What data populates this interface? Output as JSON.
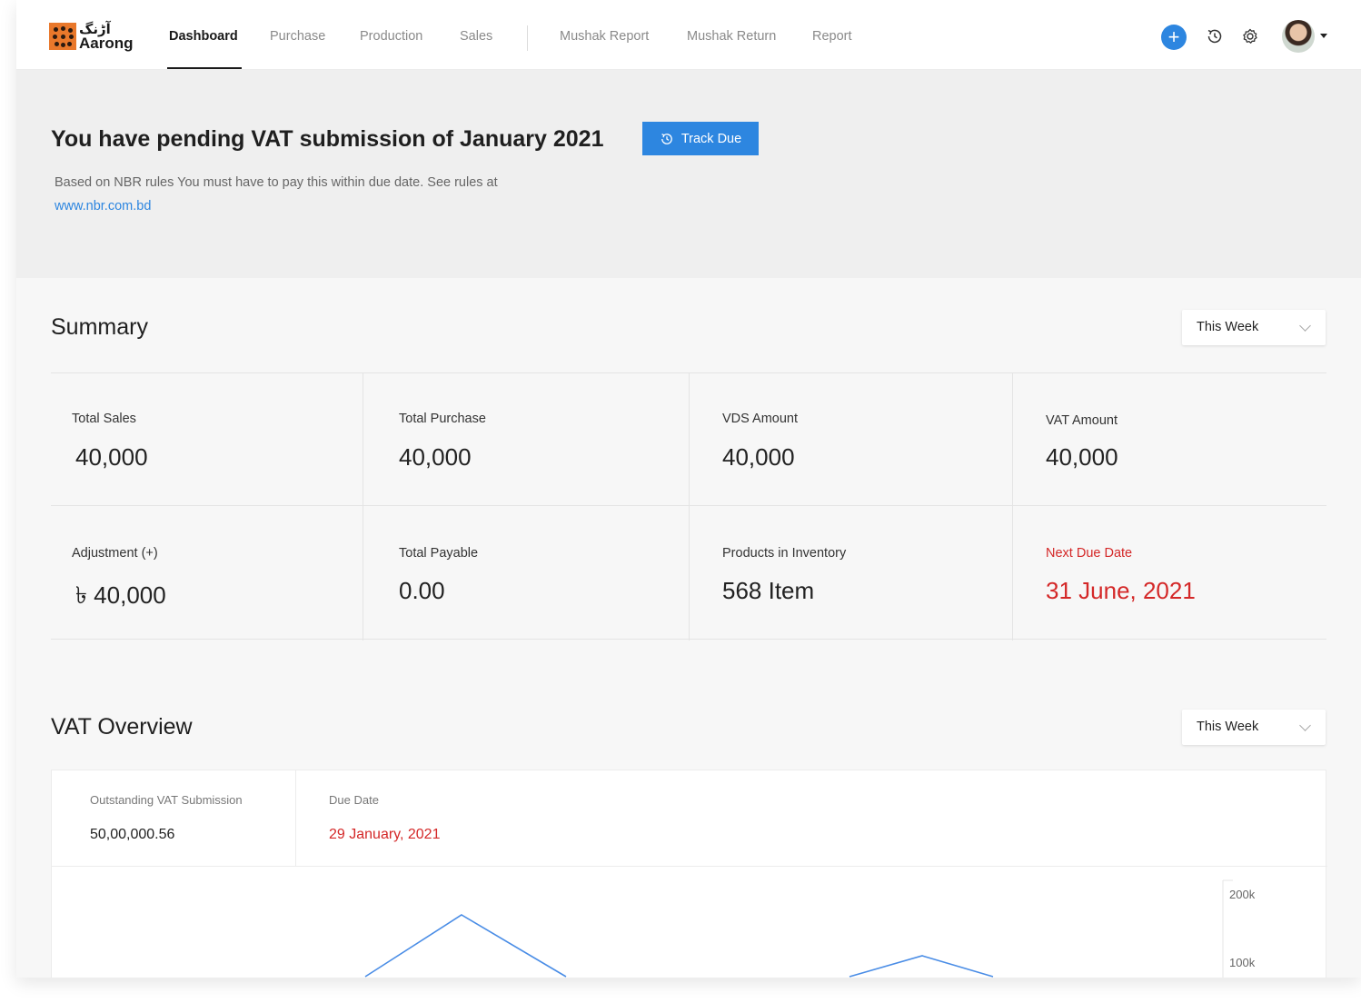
{
  "brand": {
    "line1": "آڑنگ",
    "line2": "Aarong"
  },
  "nav": {
    "items": [
      {
        "label": "Dashboard",
        "active": true
      },
      {
        "label": "Purchase"
      },
      {
        "label": "Production"
      },
      {
        "label": "Sales"
      },
      {
        "label": "Mushak Report"
      },
      {
        "label": "Mushak Return"
      },
      {
        "label": "Report"
      }
    ],
    "add_symbol": "+",
    "icons": [
      "plus-icon",
      "history-icon",
      "gear-icon",
      "avatar",
      "caret-down-icon"
    ]
  },
  "banner": {
    "title": "You have pending VAT submission of January 2021",
    "button": "Track Due",
    "text": "Based on NBR rules You must have to pay this within due date. See rules at",
    "link": "www.nbr.com.bd"
  },
  "summary": {
    "title": "Summary",
    "period": "This Week",
    "cells": [
      {
        "label": "Total Sales",
        "value": "40,000"
      },
      {
        "label": "Total Purchase",
        "value": "40,000"
      },
      {
        "label": "VDS Amount",
        "value": "40,000"
      },
      {
        "label": "VAT Amount",
        "value": "40,000"
      },
      {
        "label": "Adjustment (+)",
        "value": "৳ 40,000"
      },
      {
        "label": "Total Payable",
        "value": "0.00"
      },
      {
        "label": "Products in Inventory",
        "value": "568 Item"
      },
      {
        "label": "Next Due Date",
        "value": "31 June, 2021"
      }
    ]
  },
  "vat_overview": {
    "title": "VAT Overview",
    "period": "This Week",
    "outstanding_label": "Outstanding VAT Submission",
    "outstanding_value": "50,00,000.56",
    "due_label": "Due Date",
    "due_value": "29 January, 2021",
    "axis_ticks": [
      "200k",
      "100k"
    ]
  },
  "colors": {
    "accent": "#2d86e0",
    "danger": "#d42828",
    "brand": "#e9782b"
  }
}
